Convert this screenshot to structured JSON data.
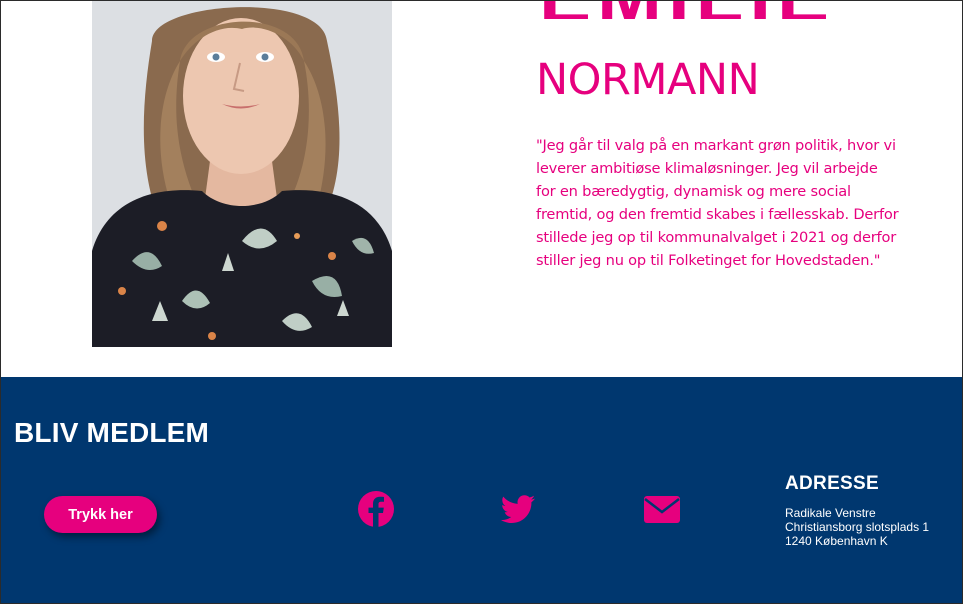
{
  "profile": {
    "first_name": "EMILIE",
    "last_name": "NORMANN",
    "quote_lines": [
      "\"Jeg går til valg på en markant grøn politik, hvor vi",
      "leverer ambitiøse klimaløsninger. Jeg vil arbejde",
      "for en bæredygtig, dynamisk og mere social",
      "fremtid, og den fremtid skabes i fællesskab. Derfor",
      "stillede jeg op til kommunalvalget i 2021 og derfor",
      "stiller jeg nu op til Folketinget for Hovedstaden.\""
    ]
  },
  "footer": {
    "title": "BLIV MEDLEM",
    "cta_label": "Trykk her",
    "social_icons": [
      "facebook-icon",
      "twitter-icon",
      "email-icon"
    ],
    "address": {
      "title": "ADRESSE",
      "lines": [
        "Radikale Venstre",
        "Christiansborg slotsplads 1",
        "1240 København K"
      ]
    }
  },
  "colors": {
    "accent": "#e6007e",
    "footer_bg": "#00376f",
    "text_light": "#ffffff"
  }
}
